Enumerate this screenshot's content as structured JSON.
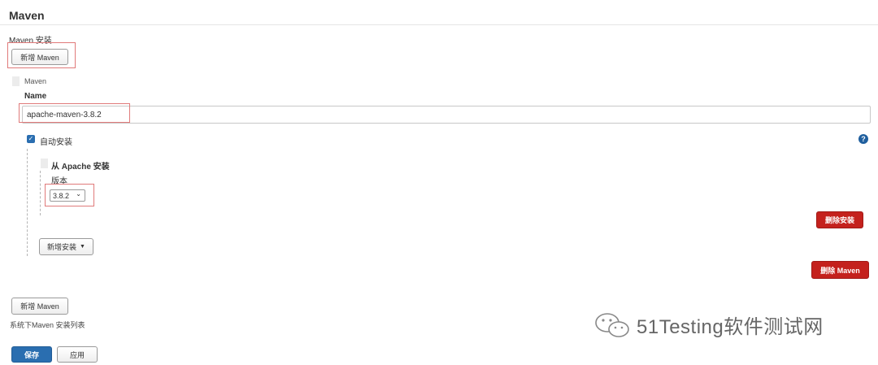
{
  "section": {
    "title": "Maven"
  },
  "installations": {
    "label": "Maven 安装",
    "add_button_top": "新增 Maven",
    "add_button_bottom": "新增 Maven",
    "list_caption": "系统下Maven 安装列表"
  },
  "maven_entry": {
    "header": "Maven",
    "name_label": "Name",
    "name_value": "apache-maven-3.8.2",
    "auto_install": {
      "label": "自动安装",
      "checked": true
    },
    "installer": {
      "title": "从 Apache 安装",
      "version_label": "版本",
      "version_selected": "3.8.2"
    },
    "delete_installer_button": "删除安装",
    "add_installer_button": "新增安装",
    "delete_maven_button": "删除 Maven"
  },
  "footer": {
    "save_button": "保存",
    "apply_button": "应用"
  },
  "watermark": {
    "text": "51Testing软件测试网"
  },
  "colors": {
    "danger": "#c4211d",
    "primary": "#2a6eb0",
    "highlight": "#e07a7a",
    "help": "#1f5f9e"
  },
  "icons": [
    "help-icon",
    "checkbox-checked-icon",
    "chevron-down-icon",
    "caret-down-icon",
    "drag-handle-icon",
    "wechat-icon"
  ]
}
